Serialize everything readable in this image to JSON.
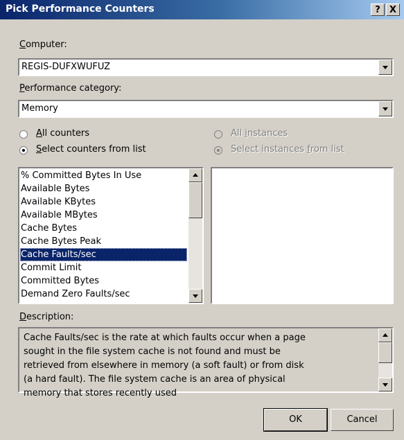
{
  "dialog": {
    "title": "Pick Performance Counters",
    "help_label": "?",
    "close_label": "X"
  },
  "computer": {
    "label_accel": "C",
    "label_rest": "omputer:",
    "value": "REGIS-DUFXWUFUZ"
  },
  "category": {
    "label_accel": "P",
    "label_rest": "erformance category:",
    "value": "Memory"
  },
  "counter_mode": {
    "all_accel": "A",
    "all_rest": "ll counters",
    "select_accel": "S",
    "select_rest": "elect counters from list",
    "selected": "select"
  },
  "instance_mode": {
    "all_pre": "All ",
    "all_accel": "i",
    "all_rest": "nstances",
    "select_pre": "Select instances ",
    "select_accel": "f",
    "select_rest": "rom list",
    "selected": "select",
    "enabled": false
  },
  "counters": {
    "items": [
      "% Committed Bytes In Use",
      "Available Bytes",
      "Available KBytes",
      "Available MBytes",
      "Cache Bytes",
      "Cache Bytes Peak",
      "Cache Faults/sec",
      "Commit Limit",
      "Committed Bytes",
      "Demand Zero Faults/sec"
    ],
    "selected_index": 6
  },
  "description": {
    "label_accel": "D",
    "label_rest": "escription:",
    "text": "Cache Faults/sec is the rate at which faults occur when a page sought in the file system cache is not found and must be retrieved from elsewhere in memory (a soft fault) or from disk (a hard fault). The file system cache is an area of physical memory that stores recently used"
  },
  "buttons": {
    "ok": "OK",
    "cancel": "Cancel"
  },
  "colors": {
    "title_bar": "#0a246a",
    "dialog_face": "#d4d0c8",
    "selection": "#0a246a"
  }
}
